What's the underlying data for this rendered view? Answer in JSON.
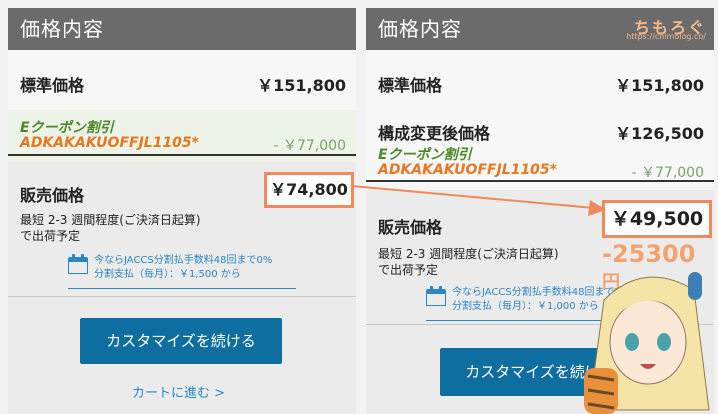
{
  "left": {
    "header": "価格内容",
    "standard_label": "標準価格",
    "standard_price": "￥151,800",
    "coupon_title": "Eクーポン割引",
    "coupon_code": "ADKAKAKUOFFJL1105*",
    "coupon_discount": "- ￥77,000",
    "sale_label": "販売価格",
    "sale_price": "￥74,800",
    "ship_line1": "最短 2-3 週間程度(ご決済日起算)",
    "ship_line2": "で出荷予定",
    "pay_line1": "今ならJACCS分割払手数料48回まで0%",
    "pay_line2": "分割支払（毎月）：￥1,500 から",
    "cta": "カスタマイズを続ける",
    "cart_link": "カートに進む >"
  },
  "right": {
    "header": "価格内容",
    "standard_label": "標準価格",
    "standard_price": "￥151,800",
    "changed_label": "構成変更後価格",
    "changed_price": "￥126,500",
    "coupon_title": "Eクーポン割引",
    "coupon_code": "ADKAKAKUOFFJL1105*",
    "coupon_discount": "- ￥77,000",
    "sale_label": "販売価格",
    "sale_price": "￥49,500",
    "diff": "-25300",
    "diff_unit": "円",
    "ship_line1": "最短 2-3 週間程度(ご決済日起算)",
    "ship_line2": "で出荷予定",
    "pay_line1": "今ならJACCS分割払手数料48回まで0%",
    "pay_line2": "分割支払（毎月）：￥1,000 から",
    "cta": "カスタマイズを続ける",
    "watermark_title": "ちもろぐ",
    "watermark_url": "https://chimolog.co/"
  },
  "colors": {
    "header_bg": "#6b6b6b",
    "cta_bg": "#0f6ea0",
    "highlight": "#f08a5a",
    "coupon_green": "#4b8a2a",
    "coupon_orange": "#e87722",
    "link_blue": "#2a86c6"
  }
}
